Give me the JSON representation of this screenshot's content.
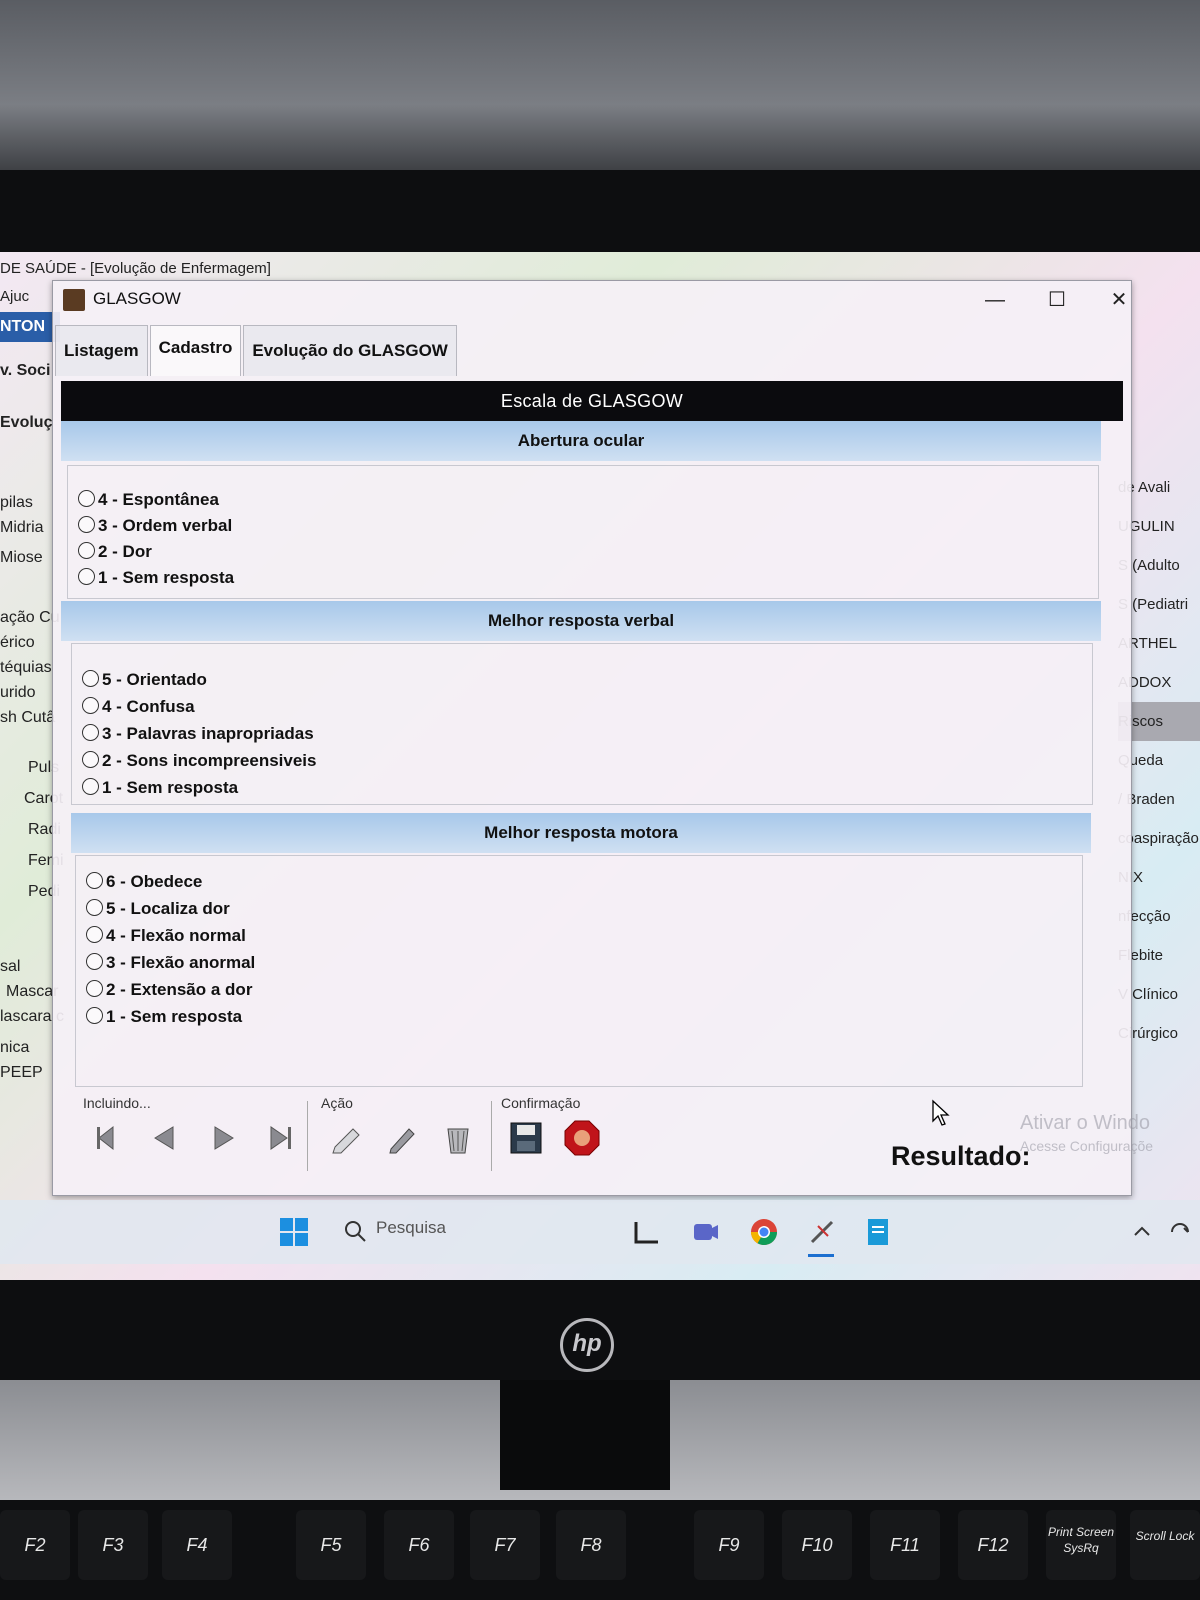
{
  "app": {
    "title": "DE SAÚDE - [Evolução de Enfermagem]",
    "menu_fragment": "Ajuc",
    "band_fragment": "NTON",
    "row_fragments": [
      "v. Soci",
      "Evoluç"
    ]
  },
  "bg_left": [
    "pilas",
    "Midria",
    "Miose",
    "ação Cu",
    "érico",
    "téquias",
    "urido",
    "sh Cutâ",
    "Puls",
    "Carot",
    "Radi",
    "Femi",
    "Pedi",
    "sal",
    "Mascar",
    "lascara c",
    "nica",
    "PEEP"
  ],
  "bg_right": [
    "de Avali",
    "UGULIN",
    "S (Adulto",
    "S (Pediatri",
    "ARTHEL",
    "ADDOX",
    "Riscos",
    "Queda",
    "/ Braden",
    "coaspiração",
    "NIX",
    "nfecção",
    "Flebite",
    "V Clínico",
    "Cirúrgico"
  ],
  "window": {
    "title": "GLASGOW",
    "controls": {
      "minimize": "—",
      "maximize": "☐",
      "close": "✕"
    },
    "tabs": [
      "Listagem",
      "Cadastro",
      "Evolução do GLASGOW"
    ],
    "active_tab": "Cadastro"
  },
  "form": {
    "header": "Escala de GLASGOW",
    "sections": [
      {
        "title": "Abertura ocular",
        "options": [
          "4 - Espontânea",
          "3 - Ordem verbal",
          "2 - Dor",
          "1 - Sem resposta"
        ]
      },
      {
        "title": "Melhor resposta verbal",
        "options": [
          "5 - Orientado",
          "4 - Confusa",
          "3 - Palavras inapropriadas",
          "2 - Sons incompreensiveis",
          "1 - Sem resposta"
        ]
      },
      {
        "title": "Melhor resposta motora",
        "options": [
          "6 - Obedece",
          "5 - Localiza dor",
          "4 - Flexão normal",
          "3 - Flexão anormal",
          "2 - Extensão a dor",
          "1 - Sem resposta"
        ]
      }
    ],
    "result_label": "Resultado:"
  },
  "toolbar": {
    "groups": [
      "Incluindo...",
      "Ação",
      "Confirmação"
    ]
  },
  "overlay": {
    "activate_1": "Ativar o Windo",
    "activate_2": "Acesse Configuraçõe"
  },
  "taskbar": {
    "search_placeholder": "Pesquisa"
  },
  "monitor": {
    "brand": "hp"
  },
  "keys": [
    "F2",
    "F3",
    "F4",
    "F5",
    "F6",
    "F7",
    "F8",
    "F9",
    "F10",
    "F11",
    "F12",
    "Print Screen SysRq",
    "Scroll Lock"
  ]
}
